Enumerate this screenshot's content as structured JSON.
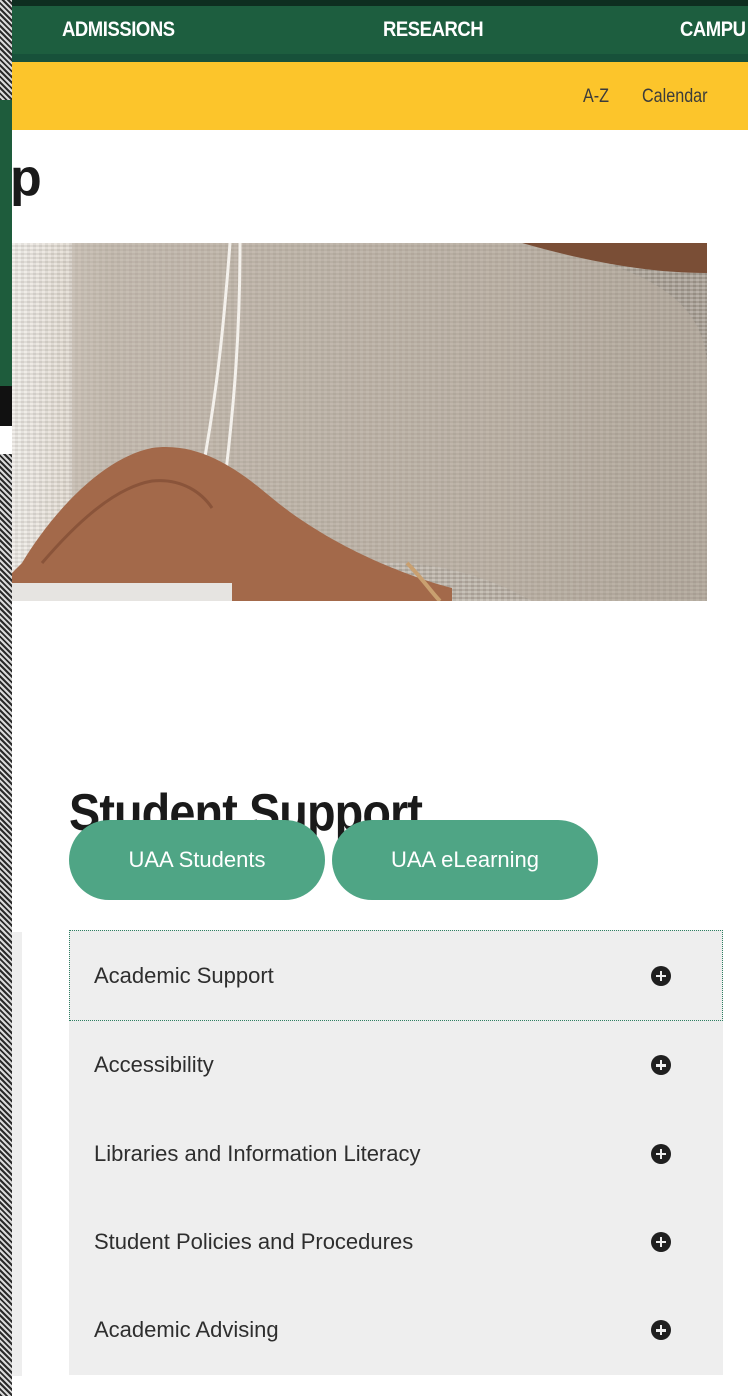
{
  "top_nav": {
    "items": [
      {
        "label": "ADMISSIONS"
      },
      {
        "label": "RESEARCH"
      },
      {
        "label": "CAMPU"
      }
    ]
  },
  "utility_nav": {
    "items": [
      {
        "label": "A-Z"
      },
      {
        "label": "Calendar"
      }
    ]
  },
  "page": {
    "title_partial": "p"
  },
  "student_support": {
    "heading": "Student Support",
    "buttons": [
      {
        "label": "UAA Students"
      },
      {
        "label": "UAA eLearning"
      }
    ],
    "accordion": [
      {
        "label": "Academic Support",
        "icon": "plus-circle-icon"
      },
      {
        "label": "Accessibility",
        "icon": "plus-circle-icon"
      },
      {
        "label": "Libraries and Information Literacy",
        "icon": "plus-circle-icon"
      },
      {
        "label": "Student Policies and Procedures",
        "icon": "plus-circle-icon"
      },
      {
        "label": "Academic Advising",
        "icon": "plus-circle-icon"
      }
    ]
  },
  "colors": {
    "nav_green": "#1d5e3f",
    "util_yellow": "#fcc52b",
    "pill_green": "#4fa585",
    "accordion_bg": "#eeeeee"
  }
}
